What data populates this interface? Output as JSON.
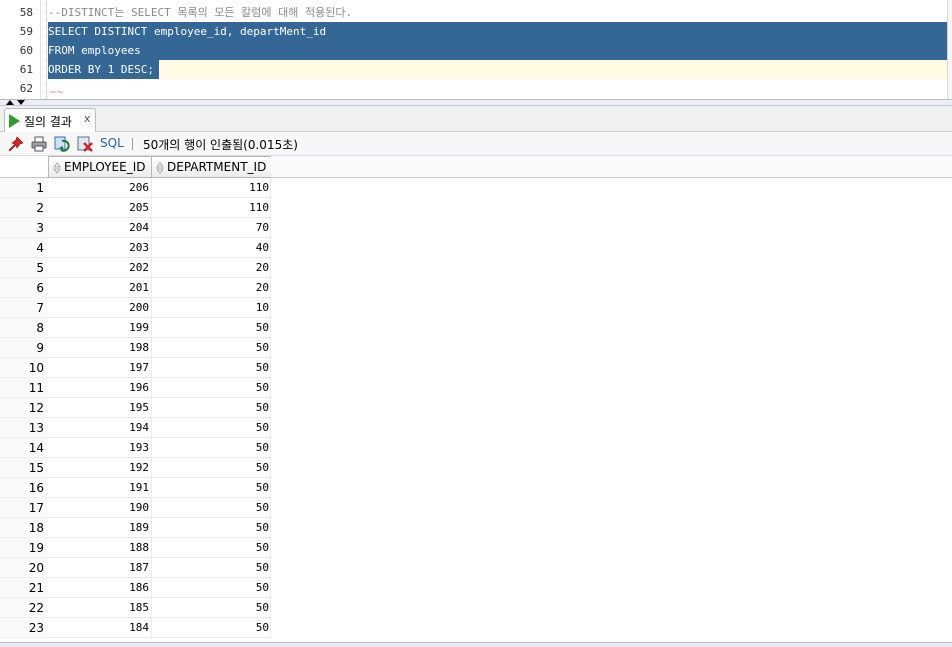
{
  "editor": {
    "lines": [
      {
        "num": "58",
        "text": "--DISTINCT는 SELECT 목록의 모든 칼럼에 대해 적용된다."
      },
      {
        "num": "59",
        "text": "SELECT DISTINCT employee_id, departMent_id"
      },
      {
        "num": "60",
        "text": "FROM employees"
      },
      {
        "num": "61",
        "text": "ORDER BY 1 DESC;"
      },
      {
        "num": "62",
        "text": ""
      }
    ],
    "squiggle": "~~"
  },
  "tab": {
    "label": "질의 결과",
    "close": "x"
  },
  "toolbar": {
    "sql_label": "SQL",
    "status": "50개의 행이 인출됨(0.015초)"
  },
  "grid": {
    "columns": [
      "EMPLOYEE_ID",
      "DEPARTMENT_ID"
    ],
    "rows": [
      {
        "n": "1",
        "employee_id": "206",
        "department_id": "110"
      },
      {
        "n": "2",
        "employee_id": "205",
        "department_id": "110"
      },
      {
        "n": "3",
        "employee_id": "204",
        "department_id": "70"
      },
      {
        "n": "4",
        "employee_id": "203",
        "department_id": "40"
      },
      {
        "n": "5",
        "employee_id": "202",
        "department_id": "20"
      },
      {
        "n": "6",
        "employee_id": "201",
        "department_id": "20"
      },
      {
        "n": "7",
        "employee_id": "200",
        "department_id": "10"
      },
      {
        "n": "8",
        "employee_id": "199",
        "department_id": "50"
      },
      {
        "n": "9",
        "employee_id": "198",
        "department_id": "50"
      },
      {
        "n": "10",
        "employee_id": "197",
        "department_id": "50"
      },
      {
        "n": "11",
        "employee_id": "196",
        "department_id": "50"
      },
      {
        "n": "12",
        "employee_id": "195",
        "department_id": "50"
      },
      {
        "n": "13",
        "employee_id": "194",
        "department_id": "50"
      },
      {
        "n": "14",
        "employee_id": "193",
        "department_id": "50"
      },
      {
        "n": "15",
        "employee_id": "192",
        "department_id": "50"
      },
      {
        "n": "16",
        "employee_id": "191",
        "department_id": "50"
      },
      {
        "n": "17",
        "employee_id": "190",
        "department_id": "50"
      },
      {
        "n": "18",
        "employee_id": "189",
        "department_id": "50"
      },
      {
        "n": "19",
        "employee_id": "188",
        "department_id": "50"
      },
      {
        "n": "20",
        "employee_id": "187",
        "department_id": "50"
      },
      {
        "n": "21",
        "employee_id": "186",
        "department_id": "50"
      },
      {
        "n": "22",
        "employee_id": "185",
        "department_id": "50"
      },
      {
        "n": "23",
        "employee_id": "184",
        "department_id": "50"
      }
    ]
  },
  "colors": {
    "selection": "#346796",
    "current_line": "#fffbe3",
    "comment": "#8a8a8a",
    "run_icon": "#2f9e2f"
  }
}
